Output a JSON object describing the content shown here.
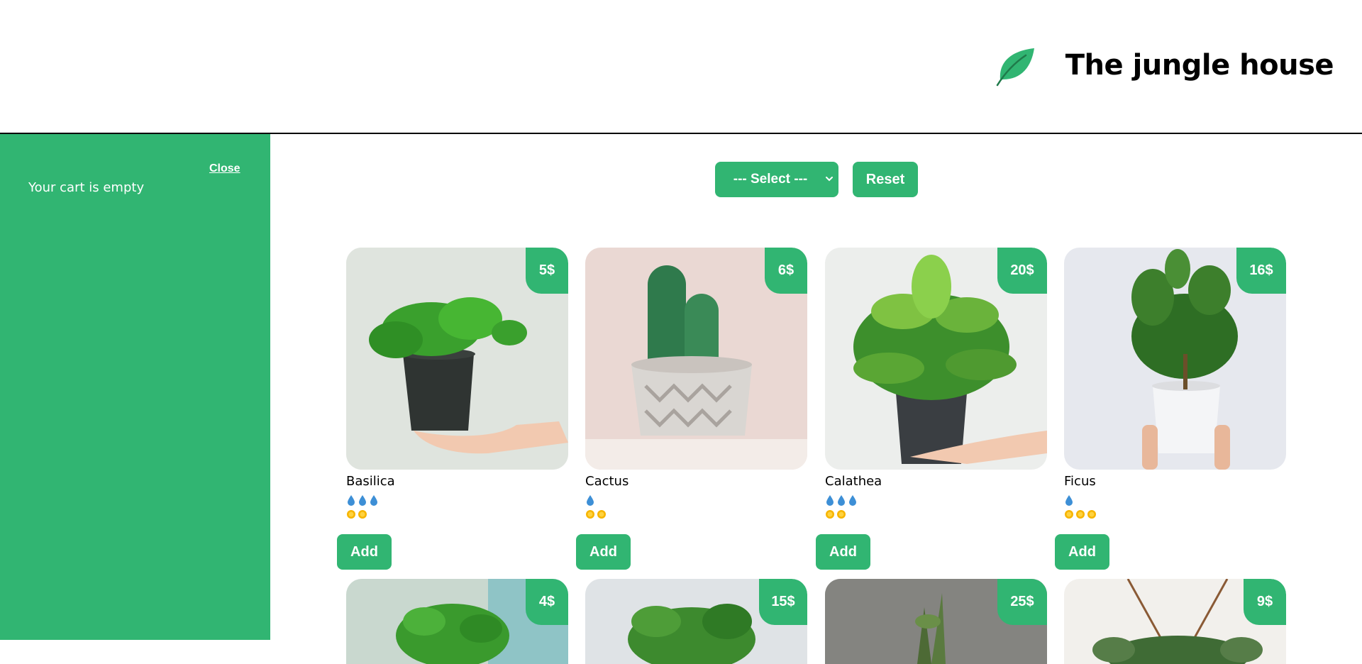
{
  "header": {
    "title": "The jungle house",
    "logo_icon": "leaf-icon",
    "brand_color": "#31b572"
  },
  "cart": {
    "close_label": "Close",
    "empty_text": "Your cart is empty"
  },
  "filters": {
    "select_label": "--- Select ---",
    "reset_label": "Reset"
  },
  "plants": [
    {
      "name": "Basilica",
      "price": "5$",
      "water": 3,
      "light": 2,
      "button": "Add"
    },
    {
      "name": "Cactus",
      "price": "6$",
      "water": 1,
      "light": 2,
      "button": "Add"
    },
    {
      "name": "Calathea",
      "price": "20$",
      "water": 3,
      "light": 2,
      "button": "Add"
    },
    {
      "name": "Ficus",
      "price": "16$",
      "water": 1,
      "light": 3,
      "button": "Add"
    },
    {
      "price": "4$"
    },
    {
      "price": "15$"
    },
    {
      "price": "25$"
    },
    {
      "price": "9$"
    }
  ]
}
